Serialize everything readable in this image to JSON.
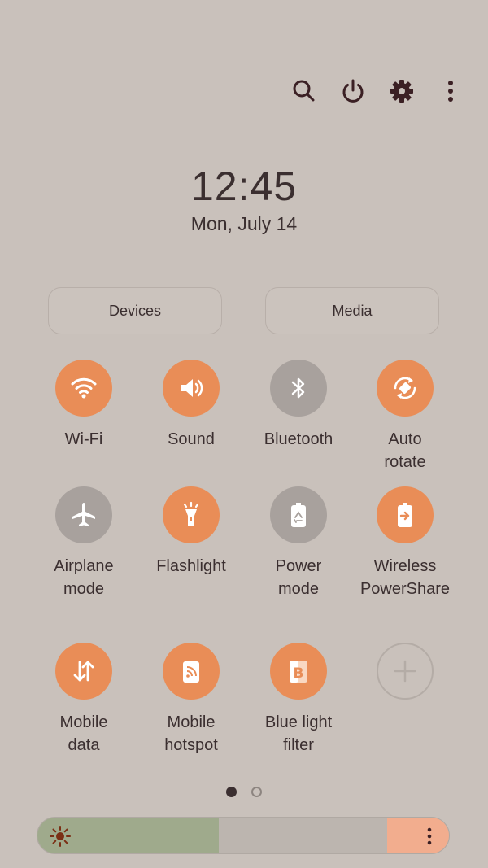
{
  "status": {
    "time": "12:45",
    "date": "Mon, July 14"
  },
  "top_actions": [
    {
      "icon": "search-icon"
    },
    {
      "icon": "power-icon"
    },
    {
      "icon": "gear-icon"
    },
    {
      "icon": "more-vert-icon"
    }
  ],
  "buttons": {
    "devices": "Devices",
    "media": "Media"
  },
  "tiles": [
    {
      "label": "Wi-Fi",
      "icon": "wifi-icon",
      "state": "on"
    },
    {
      "label": "Sound",
      "icon": "speaker-icon",
      "state": "on"
    },
    {
      "label": "Bluetooth",
      "icon": "bluetooth-icon",
      "state": "off"
    },
    {
      "label": "Auto\nrotate",
      "icon": "rotate-icon",
      "state": "on"
    },
    {
      "label": "Airplane\nmode",
      "icon": "airplane-icon",
      "state": "off"
    },
    {
      "label": "Flashlight",
      "icon": "flashlight-icon",
      "state": "on"
    },
    {
      "label": "Power\nmode",
      "icon": "battery-recycle-icon",
      "state": "off"
    },
    {
      "label": "Wireless\nPowerShare",
      "icon": "powershare-icon",
      "state": "on"
    },
    {
      "label": "Mobile\ndata",
      "icon": "data-arrows-icon",
      "state": "on"
    },
    {
      "label": "Mobile\nhotspot",
      "icon": "hotspot-icon",
      "state": "on"
    },
    {
      "label": "Blue light\nfilter",
      "icon": "blue-light-icon",
      "state": "on"
    },
    {
      "label": "",
      "icon": "plus-icon",
      "state": "add"
    }
  ],
  "pager": {
    "pages": 2,
    "current": 1
  },
  "brightness": {
    "level": 0.44,
    "icon": "sun-icon",
    "menu_icon": "more-vert-icon"
  },
  "colors": {
    "accent": "#e98d57",
    "inactive": "#a8a19d",
    "background": "#c9c1bb",
    "text": "#3b2f30"
  }
}
